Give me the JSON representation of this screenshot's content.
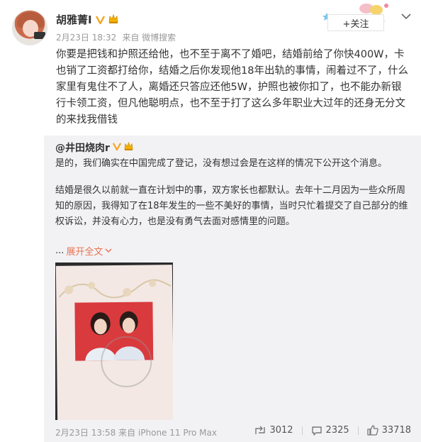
{
  "post": {
    "username": "胡雅菁I",
    "date": "2月23日 18:32",
    "source_prefix": "来自",
    "source": "微博搜索",
    "follow_label": "+关注",
    "text": "你要是把钱和护照还给他，也不至于离不了婚吧，结婚前给了你快400W，卡也销了工资都打给你，结婚之后你发现他18年出轨的事情，闹着过不了，什么家里有鬼住不了人，离婚还只答应还他5W，护照也被你扣了，也不能办新银行卡领工资，但凡他聪明点，也不至于打了这么多年职业大过年的还身无分文的来找我借钱"
  },
  "repost": {
    "author": "@井田烧肉r",
    "paragraph1": "是的，我们确实在中国完成了登记，没有想过会是在这样的情况下公开这个消息。",
    "paragraph2": "结婚是很久以前就一直在计划中的事，双方家长也都默认。去年十二月因为一些众所周知的原因，我得知了在18年发生的一些不美好的事情，当时只忙着提交了自己部分的维权诉讼，并没有心力，也是没有勇气去面对感情里的问题。",
    "expand_dots": "...",
    "expand_label": "展开全文",
    "footer": "2月23日 13:58 来自 iPhone 11 Pro Max",
    "repost_count": "3012",
    "comment_count": "2325",
    "like_count": "33718"
  },
  "colors": {
    "accent": "#eb7350",
    "follow_plus": "#ff8200",
    "repost_bg": "#f2f2f5",
    "meta_text": "#999999"
  },
  "icons": {
    "vip": "vip-icon",
    "crown": "crown-icon",
    "chevron": "chevron-down-icon",
    "repost": "share-icon",
    "comment": "comment-icon",
    "like": "thumbs-up-icon"
  }
}
